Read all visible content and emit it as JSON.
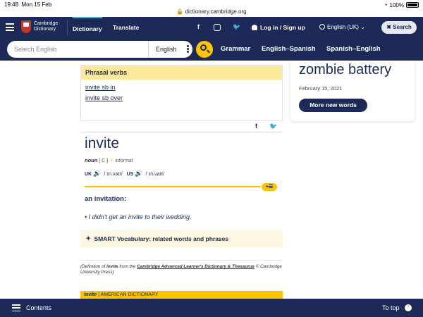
{
  "status_bar": {
    "time": "19:48",
    "date": "Mon 15 Feb",
    "url": "dictionary.cambridge.org",
    "battery": "100%"
  },
  "header": {
    "logo_line1": "Cambridge",
    "logo_line2": "Dictionary",
    "nav_dictionary": "Dictionary",
    "nav_translate": "Translate",
    "social_facebook": "f",
    "social_twitter": "t",
    "login": "Log in",
    "signup": "Sign up",
    "language": "English (UK)",
    "search_button": "Search"
  },
  "search": {
    "placeholder": "Search English",
    "dictionary": "English",
    "nav_grammar": "Grammar",
    "nav_english_spanish": "English–Spanish",
    "nav_spanish_english": "Spanish–English"
  },
  "phrasal_verbs": {
    "heading": "Phrasal verbs",
    "items": [
      "invite sb in",
      "invite sb over"
    ]
  },
  "word_of_the_day": {
    "word": "zombie battery",
    "date": "February 15, 2021",
    "button": "More new words"
  },
  "entry": {
    "headword": "invite",
    "pos": "noun",
    "grammar": "[ C ]",
    "register": "informal",
    "uk_label": "UK",
    "uk_ipa": "/ˈɪn.vaɪt/",
    "us_label": "US",
    "us_ipa": "/ˈɪn.vaɪt/",
    "definition": "an invitation:",
    "example": "I didn't get an invite to their wedding.",
    "smart_vocab": "SMART Vocabulary: related words and phrases"
  },
  "citation": {
    "prefix": "(Definition of",
    "word": "invite",
    "middle": "from the",
    "source": "Cambridge Advanced Learner's Dictionary & Thesaurus",
    "suffix": "© Cambridge University Press)"
  },
  "american": {
    "word": "invite",
    "label": "AMERICAN DICTIONARY"
  },
  "footer": {
    "contents": "Contents",
    "to_top": "To top"
  }
}
